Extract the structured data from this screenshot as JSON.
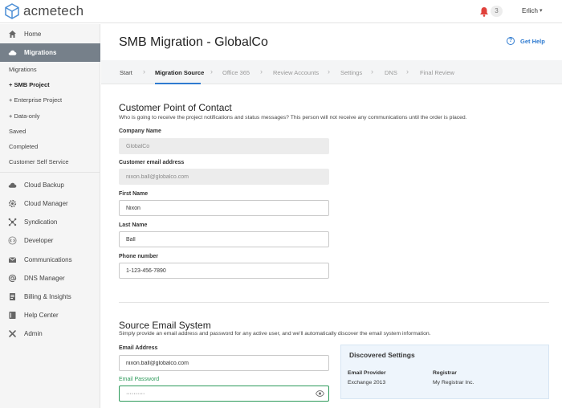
{
  "brand": {
    "name": "acmetech"
  },
  "header": {
    "notification_count": "3",
    "user_name": "Erlich",
    "user_caret": "▾"
  },
  "sidebar": {
    "home": "Home",
    "migrations": "Migrations",
    "sub_items": [
      "Migrations",
      "+ SMB Project",
      "+ Enterprise Project",
      "+ Data-only",
      "Saved",
      "Completed",
      "Customer Self Service"
    ],
    "items": [
      "Cloud Backup",
      "Cloud Manager",
      "Syndication",
      "Developer",
      "Communications",
      "DNS Manager",
      "Billing & Insights",
      "Help Center",
      "Admin"
    ]
  },
  "page": {
    "title": "SMB Migration - GlobalCo",
    "help_label": "Get Help",
    "help_icon": "?"
  },
  "steps": [
    "Start",
    "Migration Source",
    "Office 365",
    "Review Accounts",
    "Settings",
    "DNS",
    "Final Review"
  ],
  "contact": {
    "title": "Customer Point of Contact",
    "description": "Who is going to receive the project notifications and status messages? This person will not receive any communications until the order is placed.",
    "company_label": "Company Name",
    "company_value": "GlobalCo",
    "email_label": "Customer email address",
    "email_value": "nixon.ball@globalco.com",
    "first_label": "First Name",
    "first_value": "Nixon",
    "last_label": "Last Name",
    "last_value": "Ball",
    "phone_label": "Phone number",
    "phone_value": "1-123-456-7890"
  },
  "source": {
    "title": "Source Email System",
    "description": "Simply provide an email address and password for any active user, and we'll automatically discover the email system information.",
    "email_label": "Email Address",
    "email_value": "nixon.ball@globalco.com",
    "password_label": "Email Password",
    "password_value": "··········"
  },
  "discovered": {
    "title": "Discovered Settings",
    "provider_label": "Email Provider",
    "provider_value": "Exchange 2013",
    "registrar_label": "Registrar",
    "registrar_value": "My Registrar Inc."
  },
  "colors": {
    "accent": "#2f7bd0",
    "success": "#2d9a5a",
    "sidebar_active": "#76808a",
    "bell": "#e0413b"
  }
}
